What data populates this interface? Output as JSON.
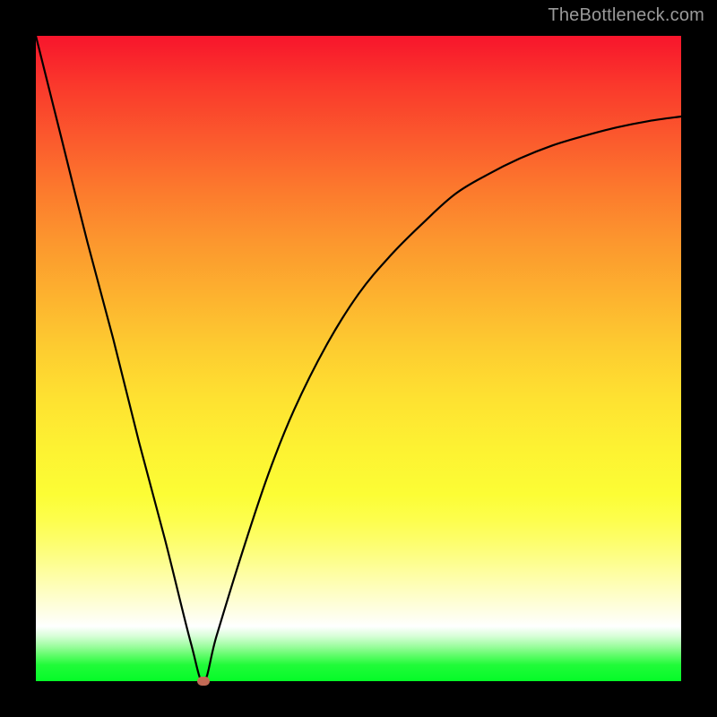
{
  "watermark": "TheBottleneck.com",
  "chart_data": {
    "type": "line",
    "title": "",
    "xlabel": "",
    "ylabel": "",
    "xlim": [
      0,
      100
    ],
    "ylim": [
      0,
      100
    ],
    "grid": false,
    "gradient": {
      "top_color": "#f8152c",
      "mid_color": "#fcfd35",
      "bottom_color": "#05fb28"
    },
    "vertex": {
      "x": 26,
      "y": 0
    },
    "marker": {
      "x": 26,
      "y": 0,
      "color": "#c26a55"
    },
    "series": [
      {
        "name": "curve",
        "x": [
          0,
          4,
          8,
          12,
          16,
          20,
          24,
          26,
          28,
          32,
          36,
          40,
          45,
          50,
          55,
          60,
          65,
          70,
          75,
          80,
          85,
          90,
          95,
          100
        ],
        "y": [
          100,
          84,
          68,
          53,
          37,
          22,
          6,
          0,
          7,
          20,
          32,
          42,
          52,
          60,
          66,
          71,
          75.5,
          78.5,
          81,
          83,
          84.5,
          85.8,
          86.8,
          87.5
        ]
      }
    ]
  }
}
